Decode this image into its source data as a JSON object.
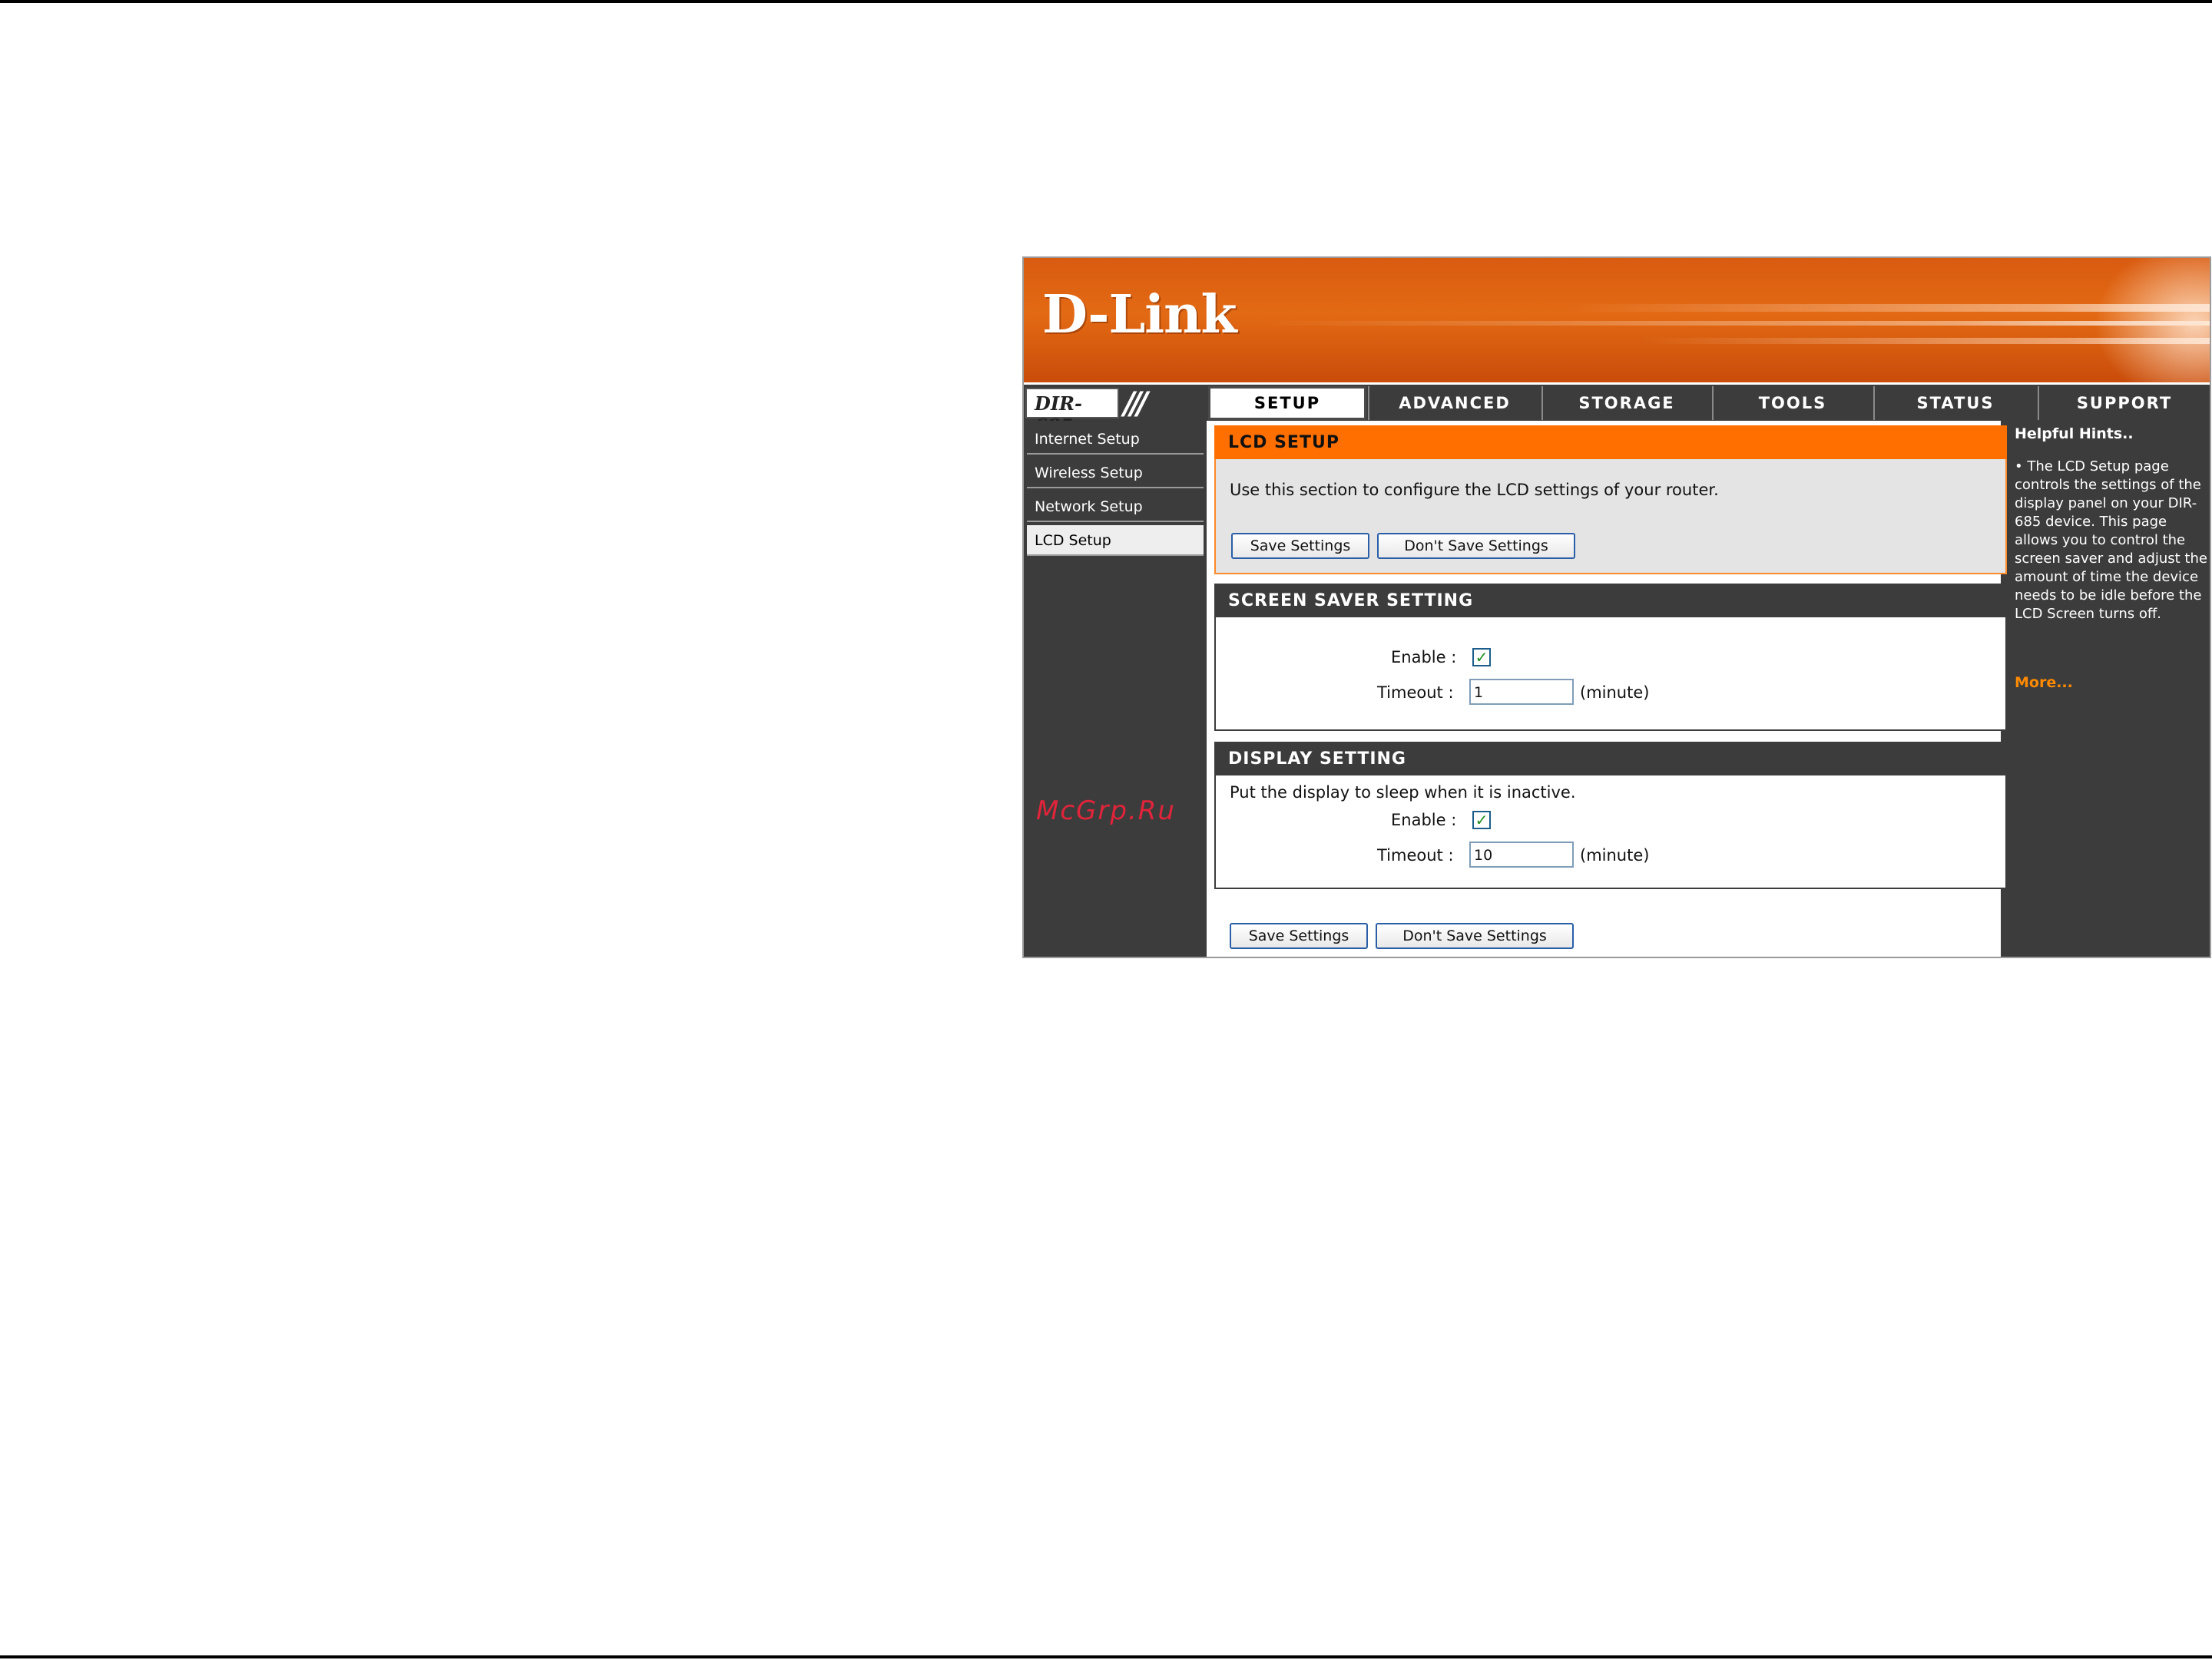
{
  "brand": {
    "logo_text": "D-Link",
    "model": "DIR-685"
  },
  "nav": {
    "tabs": [
      {
        "label": "SETUP",
        "active": true
      },
      {
        "label": "ADVANCED",
        "active": false
      },
      {
        "label": "STORAGE",
        "active": false
      },
      {
        "label": "TOOLS",
        "active": false
      },
      {
        "label": "STATUS",
        "active": false
      },
      {
        "label": "SUPPORT",
        "active": false
      }
    ]
  },
  "sidebar": {
    "items": [
      {
        "label": "Internet Setup",
        "active": false
      },
      {
        "label": "Wireless Setup",
        "active": false
      },
      {
        "label": "Network Setup",
        "active": false
      },
      {
        "label": "LCD Setup",
        "active": true
      }
    ],
    "watermark": "McGrp.Ru"
  },
  "lcd_setup": {
    "title": "LCD SETUP",
    "description": "Use this section to configure the LCD settings of your router.",
    "save_label": "Save Settings",
    "dont_save_label": "Don't Save Settings"
  },
  "screen_saver": {
    "title": "SCREEN SAVER SETTING",
    "enable_label": "Enable :",
    "enable_checked": true,
    "timeout_label": "Timeout :",
    "timeout_value": "1",
    "timeout_unit": "(minute)"
  },
  "display": {
    "title": "DISPLAY SETTING",
    "description": "Put the display to sleep when it is inactive.",
    "enable_label": "Enable :",
    "enable_checked": true,
    "timeout_label": "Timeout :",
    "timeout_value": "10",
    "timeout_unit": "(minute)"
  },
  "footer_buttons": {
    "save_label": "Save Settings",
    "dont_save_label": "Don't Save Settings"
  },
  "hints": {
    "title": "Helpful Hints..",
    "body": "• The LCD Setup page controls the settings of the display panel on your DIR-685 device. This page allows you to control the screen saver and adjust the amount of time the device needs to be idle before the LCD Screen turns off.",
    "more_label": "More..."
  },
  "colors": {
    "banner_orange": "#e36a14",
    "section_orange": "#ff6f00",
    "dark_bg": "#3c3c3c",
    "hint_link": "#ff8a00"
  }
}
